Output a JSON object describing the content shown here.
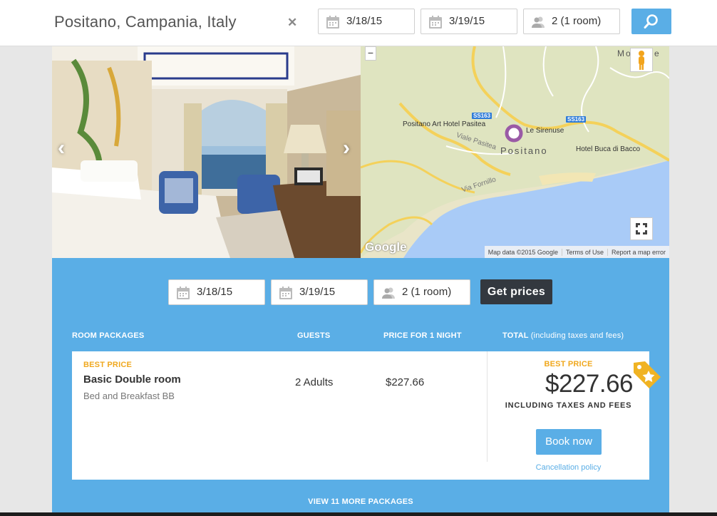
{
  "header": {
    "destination": "Positano, Campania, Italy",
    "clear_icon": "close-icon",
    "checkin": "3/18/15",
    "checkout": "3/19/15",
    "guests": "2 (1 room)",
    "search_icon": "search-icon"
  },
  "gallery": {
    "prev_icon": "chevron-left-icon",
    "next_icon": "chevron-right-icon"
  },
  "map": {
    "labels": {
      "hotel_pasitea": "Positano Art Hotel Pasitea",
      "sirenuse": "Le Sirenuse",
      "positano": "Positano",
      "buca": "Hotel Buca di Bacco",
      "viale": "Viale Pasitea",
      "fornillo": "Via Fornillo",
      "montepertuso": "Montepe",
      "ss163_a": "SS163",
      "ss163_b": "SS163"
    },
    "zoom_out": "−",
    "google": "Google",
    "footer": {
      "data": "Map data ©2015 Google",
      "terms": "Terms of Use",
      "report": "Report a map error"
    }
  },
  "prices_bar": {
    "checkin": "3/18/15",
    "checkout": "3/19/15",
    "guests": "2 (1 room)",
    "get_prices": "Get prices"
  },
  "table": {
    "headers": {
      "packages": "ROOM PACKAGES",
      "guests": "GUESTS",
      "price": "PRICE FOR 1 NIGHT",
      "total": "TOTAL",
      "total_note": "(including taxes and fees)"
    },
    "package": {
      "badge_left": "BEST PRICE",
      "room_name": "Basic Double room",
      "room_sub": "Bed and Breakfast BB",
      "guests": "2 Adults",
      "price_per_night": "$227.66",
      "badge_right": "BEST PRICE",
      "total": "$227.66",
      "incl": "INCLUDING TAXES AND FEES",
      "book": "Book now",
      "cancel": "Cancellation policy"
    },
    "more": "VIEW 11 MORE PACKAGES"
  },
  "colors": {
    "accent": "#5aaee6",
    "best_price": "#f0a81e",
    "dark_button": "#33383f"
  }
}
